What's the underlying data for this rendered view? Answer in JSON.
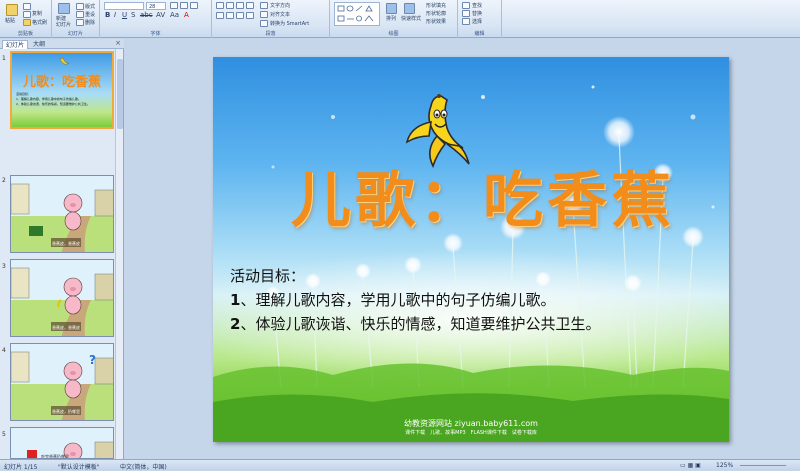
{
  "ribbon": {
    "groups": [
      "剪贴板",
      "幻灯片",
      "字体",
      "段落",
      "绘图",
      "编辑"
    ],
    "clipboard": {
      "paste": "粘贴",
      "copy": "复制",
      "format_painter": "格式刷"
    },
    "slides": {
      "new_slide": "新建\n幻灯片",
      "layout": "版式",
      "reset": "重设",
      "delete": "删除"
    },
    "font": {
      "size": "28"
    },
    "paragraph": {
      "align_text": "对齐文本",
      "convert_smartart": "转换为 SmartArt"
    },
    "drawing": {
      "arrange": "排列",
      "quick_styles": "快速样式",
      "shape_fill": "形状填充",
      "shape_outline": "形状轮廓",
      "shape_effects": "形状效果"
    },
    "editing": {
      "find": "查找",
      "replace": "替换",
      "select": "选择"
    }
  },
  "panel": {
    "tabs": [
      "幻灯片",
      "大纲"
    ],
    "slide_numbers": [
      "1",
      "2",
      "3",
      "4",
      "5"
    ],
    "thumb1": {
      "title": "儿歌：吃香蕉",
      "lines": [
        "活动目标：",
        "1、理解儿歌内容，学用儿歌中的句子仿编儿歌。",
        "2、体验儿歌诙谐、快乐的情感，知道要维护公共卫生。"
      ]
    },
    "thumb_captions": [
      "香蕉皮，香蕉皮",
      "香蕉皮，香蕉皮",
      "香蕉皮，扔哪里",
      "吃完香蕉扔哪里"
    ]
  },
  "slide": {
    "title": "儿歌：吃香蕉",
    "goals_heading": "活动目标：",
    "goal1_num": "1",
    "goal1_text": "、理解儿歌内容，学用儿歌中的句子仿编儿歌。",
    "goal2_num": "2",
    "goal2_text": "、体验儿歌诙谐、快乐的情感，知道要维护公共卫生。",
    "footer_site": "幼教资源网站 ziyuan.baby611.com",
    "footer_links": "课件下载　儿歌、故事MP3　FLASH课件下载　试卷下载库"
  },
  "status": {
    "slide_pos": "幻灯片 1/15",
    "theme": "\"默认设计模板\"",
    "language": "中文(简体，中国)",
    "zoom": "125%"
  }
}
